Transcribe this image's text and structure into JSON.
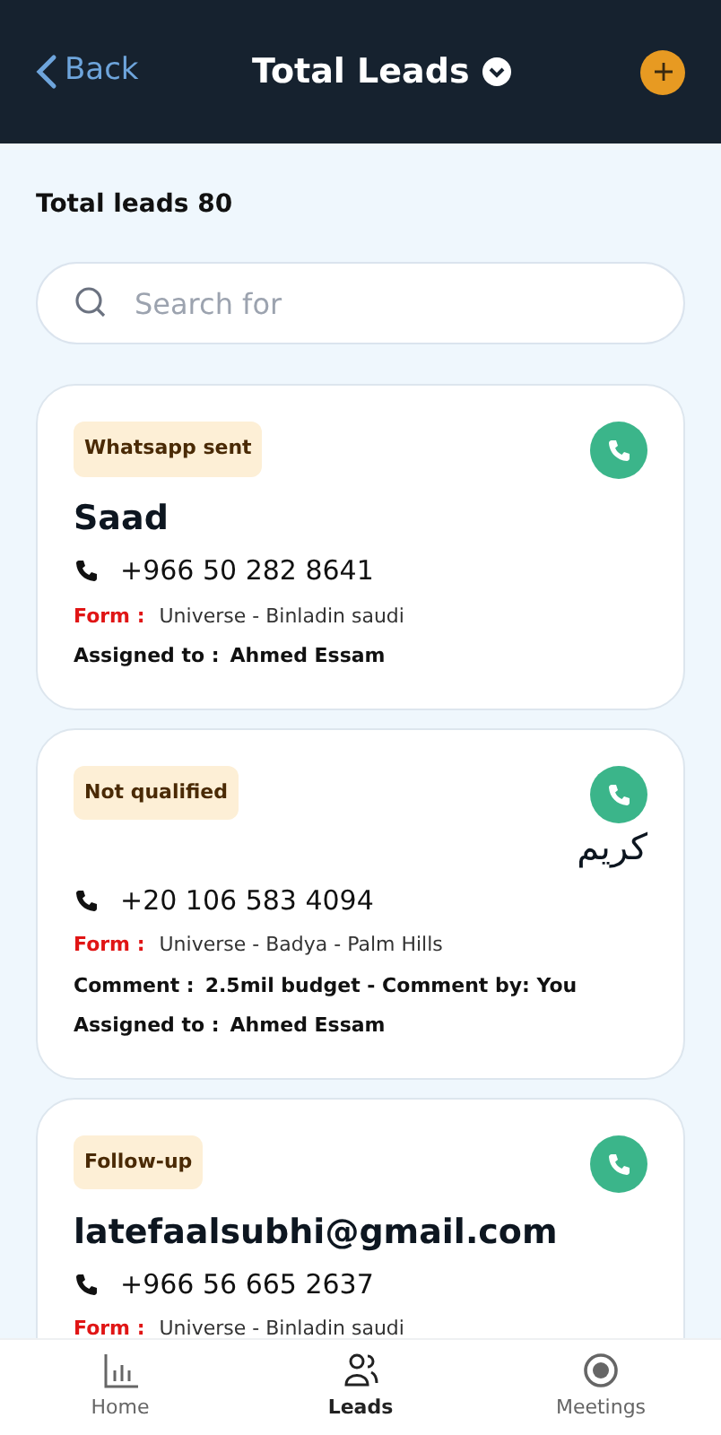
{
  "header": {
    "back_label": "Back",
    "title": "Total Leads"
  },
  "summary": "Total leads 80",
  "search": {
    "placeholder": "Search for"
  },
  "leads": [
    {
      "status": "Whatsapp sent",
      "name": "Saad",
      "rtl": false,
      "phone": "+966 50 282 8641",
      "form_label": "Form :",
      "form": "Universe - Binladin saudi",
      "assigned_label": "Assigned to :",
      "assigned": "Ahmed Essam"
    },
    {
      "status": "Not qualified",
      "name": "كريم",
      "rtl": true,
      "phone": "+20 106 583 4094",
      "form_label": "Form :",
      "form": "Universe - Badya - Palm Hills",
      "comment_label": "Comment :",
      "comment": "2.5mil budget - Comment by: You",
      "assigned_label": "Assigned to :",
      "assigned": "Ahmed Essam"
    },
    {
      "status": "Follow-up",
      "name": "latefaalsubhi@gmail.com",
      "rtl": false,
      "phone": "+966 56 665 2637",
      "form_label": "Form :",
      "form": "Universe - Binladin saudi"
    }
  ],
  "nav": [
    {
      "label": "Home",
      "selected": false
    },
    {
      "label": "Leads",
      "selected": true
    },
    {
      "label": "Meetings",
      "selected": false
    }
  ]
}
